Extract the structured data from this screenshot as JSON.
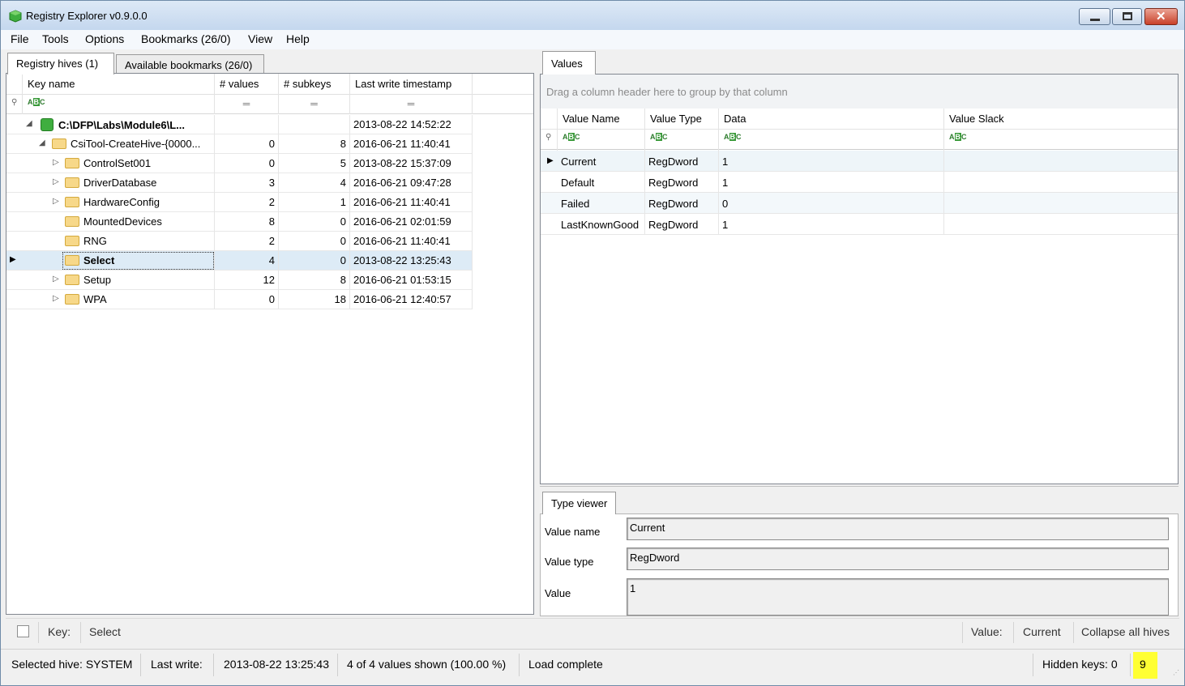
{
  "app": {
    "title": "Registry Explorer v0.9.0.0"
  },
  "menu": [
    "File",
    "Tools",
    "Options",
    "Bookmarks (26/0)",
    "View",
    "Help"
  ],
  "left_tabs": [
    "Registry hives (1)",
    "Available bookmarks (26/0)"
  ],
  "keys_grid": {
    "headers": [
      "Key name",
      "# values",
      "# subkeys",
      "Last write timestamp"
    ],
    "rows": [
      {
        "name": "C:\\DFP\\Labs\\Module6\\L...",
        "values": "",
        "subkeys": "",
        "timestamp": "2013-08-22 14:52:22"
      },
      {
        "name": "CsiTool-CreateHive-{0000...",
        "values": "0",
        "subkeys": "8",
        "timestamp": "2016-06-21 11:40:41"
      },
      {
        "name": "ControlSet001",
        "values": "0",
        "subkeys": "5",
        "timestamp": "2013-08-22 15:37:09"
      },
      {
        "name": "DriverDatabase",
        "values": "3",
        "subkeys": "4",
        "timestamp": "2016-06-21 09:47:28"
      },
      {
        "name": "HardwareConfig",
        "values": "2",
        "subkeys": "1",
        "timestamp": "2016-06-21 11:40:41"
      },
      {
        "name": "MountedDevices",
        "values": "8",
        "subkeys": "0",
        "timestamp": "2016-06-21 02:01:59"
      },
      {
        "name": "RNG",
        "values": "2",
        "subkeys": "0",
        "timestamp": "2016-06-21 11:40:41"
      },
      {
        "name": "Select",
        "values": "4",
        "subkeys": "0",
        "timestamp": "2013-08-22 13:25:43"
      },
      {
        "name": "Setup",
        "values": "12",
        "subkeys": "8",
        "timestamp": "2016-06-21 01:53:15"
      },
      {
        "name": "WPA",
        "values": "0",
        "subkeys": "18",
        "timestamp": "2016-06-21 12:40:57"
      }
    ]
  },
  "values_tab": "Values",
  "values_grid": {
    "group_hint": "Drag a column header here to group by that column",
    "headers": [
      "Value Name",
      "Value Type",
      "Data",
      "Value Slack"
    ],
    "rows": [
      {
        "name": "Current",
        "type": "RegDword",
        "data": "1",
        "slack": ""
      },
      {
        "name": "Default",
        "type": "RegDword",
        "data": "1",
        "slack": ""
      },
      {
        "name": "Failed",
        "type": "RegDword",
        "data": "0",
        "slack": ""
      },
      {
        "name": "LastKnownGood",
        "type": "RegDword",
        "data": "1",
        "slack": ""
      }
    ]
  },
  "type_viewer": {
    "tab": "Type viewer",
    "labels": [
      "Value name",
      "Value type",
      "Value"
    ],
    "value_name": "Current",
    "value_type": "RegDword",
    "value": "1"
  },
  "bottom_bar": {
    "key_label": "Key:",
    "key_value": "Select",
    "value_label": "Value:",
    "value_value": "Current",
    "collapse": "Collapse all hives"
  },
  "status": {
    "selected_hive": "Selected hive: SYSTEM",
    "last_write_label": "Last write:",
    "last_write_value": "2013-08-22 13:25:43",
    "shown": "4 of 4 values shown (100.00 %)",
    "load": "Load complete",
    "hidden_keys": "Hidden keys: 0",
    "count": "9"
  },
  "colors": {
    "selected_row": "#ddebf6",
    "highlight": "#ffff33",
    "accent": "#3fae3f"
  }
}
